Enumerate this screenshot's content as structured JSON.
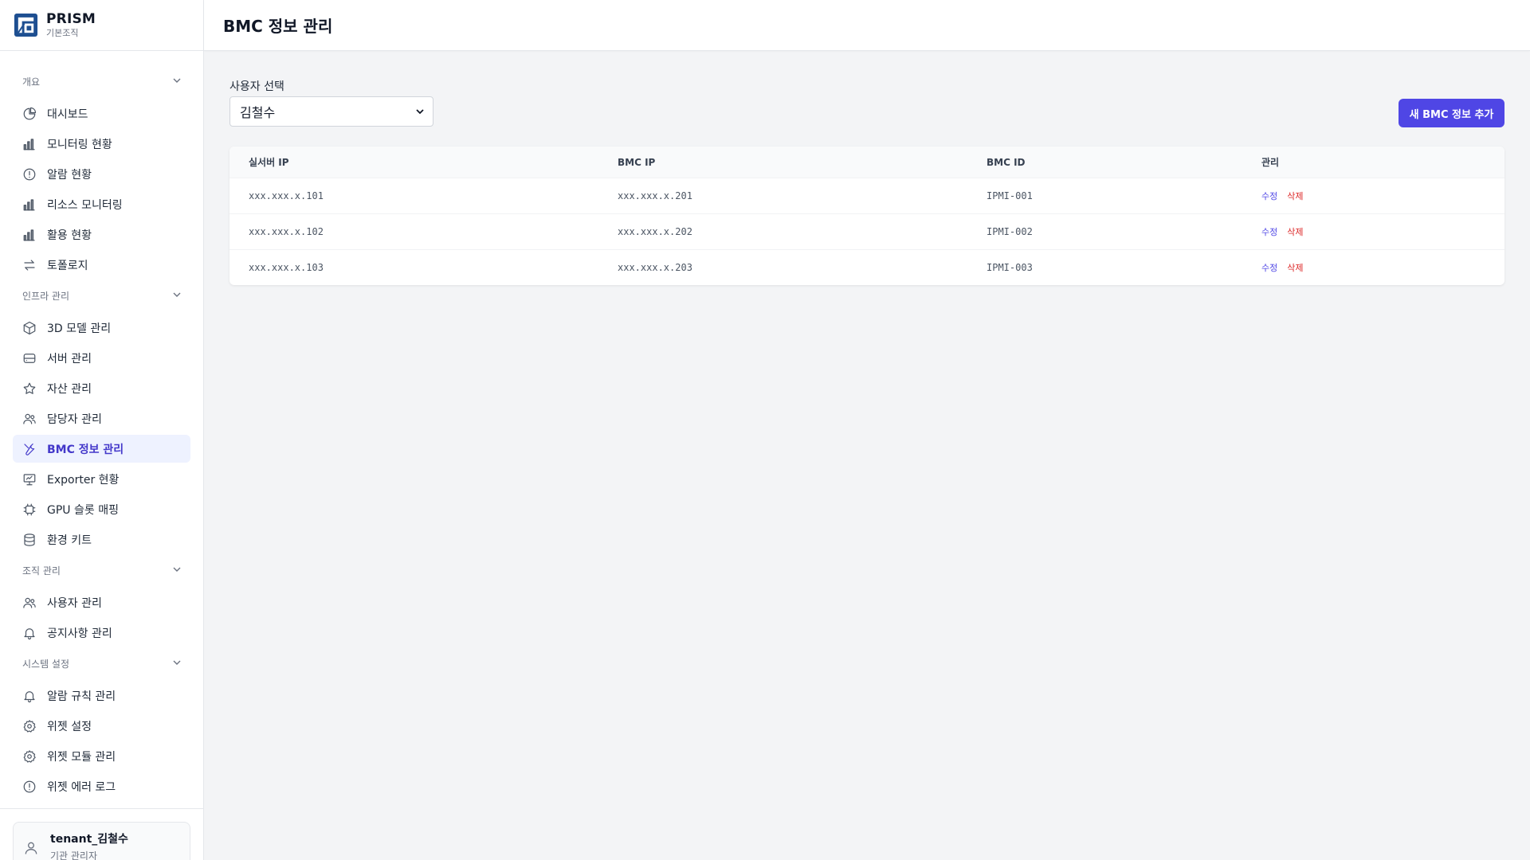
{
  "brand": {
    "name": "PRISM",
    "subtitle": "기본조직"
  },
  "header": {
    "title": "BMC 정보 관리"
  },
  "sidebar": {
    "sections": [
      {
        "label": "개요",
        "items": [
          {
            "label": "대시보드",
            "icon": "pie-chart-icon"
          },
          {
            "label": "모니터링 현황",
            "icon": "bar-chart-icon"
          },
          {
            "label": "알람 현황",
            "icon": "alert-circle-icon"
          },
          {
            "label": "리소스 모니터링",
            "icon": "bar-chart-icon"
          },
          {
            "label": "활용 현황",
            "icon": "bar-chart-icon"
          },
          {
            "label": "토폴로지",
            "icon": "arrows-swap-icon"
          }
        ]
      },
      {
        "label": "인프라 관리",
        "items": [
          {
            "label": "3D 모델 관리",
            "icon": "cube-icon"
          },
          {
            "label": "서버 관리",
            "icon": "server-icon"
          },
          {
            "label": "자산 관리",
            "icon": "star-icon"
          },
          {
            "label": "담당자 관리",
            "icon": "users-icon"
          },
          {
            "label": "BMC 정보 관리",
            "icon": "wrench-icon",
            "active": true
          },
          {
            "label": "Exporter 현황",
            "icon": "presentation-icon"
          },
          {
            "label": "GPU 슬롯 매핑",
            "icon": "chip-icon"
          },
          {
            "label": "환경 키트",
            "icon": "database-icon"
          }
        ]
      },
      {
        "label": "조직 관리",
        "items": [
          {
            "label": "사용자 관리",
            "icon": "users-icon"
          },
          {
            "label": "공지사항 관리",
            "icon": "bell-icon"
          }
        ]
      },
      {
        "label": "시스템 설정",
        "items": [
          {
            "label": "알람 규칙 관리",
            "icon": "bell-icon"
          },
          {
            "label": "위젯 설정",
            "icon": "gear-icon"
          },
          {
            "label": "위젯 모듈 관리",
            "icon": "gear-icon"
          },
          {
            "label": "위젯 에러 로그",
            "icon": "alert-circle-icon"
          }
        ]
      }
    ]
  },
  "user": {
    "name": "tenant_김철수",
    "role": "기관 관리자"
  },
  "main": {
    "select_label": "사용자 선택",
    "selected_user": "김철수",
    "add_button": "새 BMC 정보 추가",
    "table": {
      "headers": [
        "실서버 IP",
        "BMC IP",
        "BMC ID",
        "관리"
      ],
      "rows": [
        [
          "xxx.xxx.x.101",
          "xxx.xxx.x.201",
          "IPMI-001"
        ],
        [
          "xxx.xxx.x.102",
          "xxx.xxx.x.202",
          "IPMI-002"
        ],
        [
          "xxx.xxx.x.103",
          "xxx.xxx.x.203",
          "IPMI-003"
        ]
      ],
      "edit_label": "수정",
      "delete_label": "삭제"
    }
  },
  "colors": {
    "accent": "#4f46e5",
    "danger": "#dc2626",
    "active_bg": "#eef2ff"
  }
}
